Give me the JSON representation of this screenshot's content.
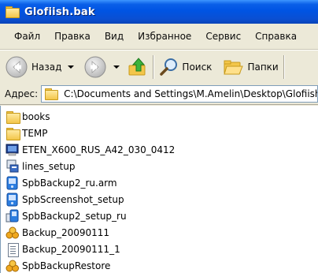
{
  "window": {
    "title": "Glofiish.bak"
  },
  "menu": {
    "items": [
      "Файл",
      "Правка",
      "Вид",
      "Избранное",
      "Сервис",
      "Справка"
    ]
  },
  "toolbar": {
    "back_label": "Назад",
    "search_label": "Поиск",
    "folders_label": "Папки"
  },
  "address": {
    "label": "Адрес:",
    "path": "C:\\Documents and Settings\\M.Amelin\\Desktop\\Glofiish"
  },
  "files": [
    {
      "name": "books",
      "icon": "folder-icon"
    },
    {
      "name": "TEMP",
      "icon": "folder-icon"
    },
    {
      "name": "ETEN_X600_RUS_A42_030_0412",
      "icon": "application-icon"
    },
    {
      "name": "lines_setup",
      "icon": "installer-icon"
    },
    {
      "name": "SpbBackup2_ru.arm",
      "icon": "spb-arm-icon"
    },
    {
      "name": "SpbScreenshot_setup",
      "icon": "spb-setup-icon"
    },
    {
      "name": "SpbBackup2_setup_ru",
      "icon": "spb-setup-icon"
    },
    {
      "name": "Backup_20090111",
      "icon": "backup-icon"
    },
    {
      "name": "Backup_20090111_1",
      "icon": "document-icon"
    },
    {
      "name": "SpbBackupRestore",
      "icon": "backup-icon"
    }
  ],
  "colors": {
    "titlebar": "#0054e3",
    "chrome": "#ece9d8",
    "address_border": "#7f9db9"
  }
}
